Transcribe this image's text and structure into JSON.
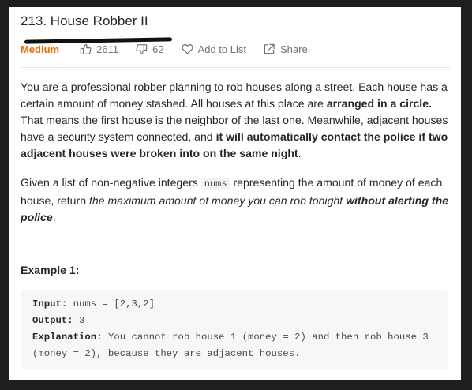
{
  "problem": {
    "title": "213. House Robber II",
    "difficulty": "Medium",
    "likes": "2611",
    "dislikes": "62",
    "add_to_list": "Add to List",
    "share": "Share"
  },
  "description": {
    "p1": {
      "t1": "You are a professional robber planning to rob houses along a street. Each house has a certain amount of money stashed. All houses at this place are ",
      "b1": "arranged in a circle.",
      "t2": " That means the first house is the neighbor of the last one. Meanwhile, adjacent houses have a security system connected, and ",
      "b2": "it will automatically contact the police if two adjacent houses were broken into on the same night",
      "t3": "."
    },
    "p2": {
      "t1": "Given a list of non-negative integers ",
      "code": "nums",
      "t2": " representing the amount of money of each house, return ",
      "i1": "the maximum amount of money you can rob tonight ",
      "bi1": "without alerting the police",
      "t3": "."
    }
  },
  "example1": {
    "title": "Example 1:",
    "input_label": "Input:",
    "input_value": " nums = [2,3,2]",
    "output_label": "Output:",
    "output_value": " 3",
    "explanation_label": "Explanation:",
    "explanation_value": " You cannot rob house 1 (money = 2) and then rob house 3 (money = 2), because they are adjacent houses."
  },
  "icons": [
    "thumbs-up-icon",
    "thumbs-down-icon",
    "heart-icon",
    "share-icon"
  ],
  "colors": {
    "difficulty": "#ef6c00",
    "text": "#262626",
    "muted": "#737373"
  }
}
